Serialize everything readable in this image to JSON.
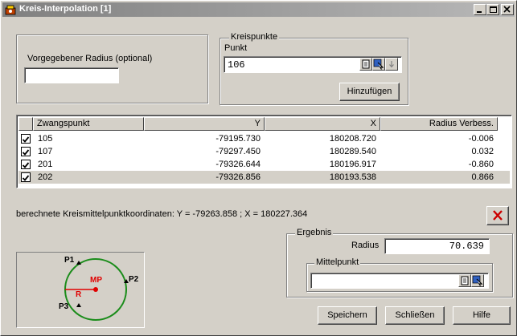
{
  "window": {
    "title": "Kreis-Interpolation [1]",
    "controls": {
      "minimize": "_",
      "maximize": "□",
      "close": "×"
    }
  },
  "radius_group": {
    "label": "Vorgegebener Radius (optional)",
    "value": ""
  },
  "kreispunkte": {
    "group_label": "Kreispunkte",
    "punkt_label": "Punkt",
    "punkt_value": "106",
    "add_button": "Hinzufügen"
  },
  "table": {
    "columns": [
      "Zwangspunkt",
      "Y",
      "X",
      "Radius Verbess."
    ],
    "rows": [
      {
        "checked": true,
        "point": "105",
        "y": "-79195.730",
        "x": "180208.720",
        "radius": "-0.006"
      },
      {
        "checked": true,
        "point": "107",
        "y": "-79297.450",
        "x": "180289.540",
        "radius": "0.032"
      },
      {
        "checked": true,
        "point": "201",
        "y": "-79326.644",
        "x": "180196.917",
        "radius": "-0.860"
      },
      {
        "checked": true,
        "point": "202",
        "y": "-79326.856",
        "x": "180193.538",
        "radius": "0.866"
      }
    ]
  },
  "result_text": "berechnete Kreismittelpunktkoordinaten: Y = -79263.858 ; X = 180227.364",
  "diagram": {
    "labels": {
      "p1": "P1",
      "p2": "P2",
      "p3": "P3",
      "mp": "MP",
      "r": "R"
    },
    "colors": {
      "circle": "#1a8c1a",
      "center": "#e00000"
    }
  },
  "ergebnis": {
    "group_label": "Ergebnis",
    "radius_label": "Radius",
    "radius_value": "70.639",
    "mittelpunkt_label": "Mittelpunkt",
    "mittelpunkt_value": ""
  },
  "buttons": {
    "save": "Speichern",
    "close": "Schließen",
    "help": "Hilfe"
  },
  "colors": {
    "titlebar": "#808080",
    "delete_icon": "#cc0000",
    "selected_row": "#d4d0c8"
  }
}
